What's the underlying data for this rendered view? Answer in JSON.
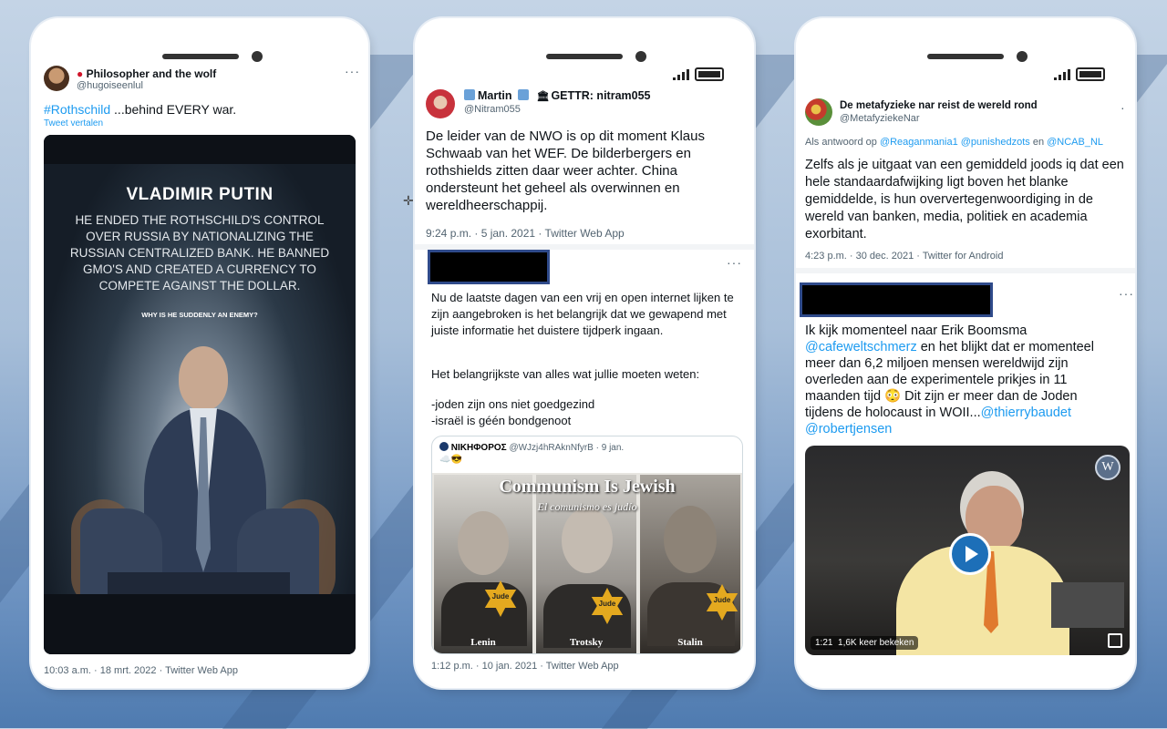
{
  "phone1": {
    "account_name": "Philosopher and the wolf",
    "handle": "@hugoiseenlul",
    "hashtag": "#Rothschild",
    "tweet_rest": " ...behind EVERY war.",
    "translate": "Tweet vertalen",
    "image": {
      "title": "VLADIMIR PUTIN",
      "text": "HE ENDED THE ROTHSCHILD'S CONTROL OVER RUSSIA BY NATIONALIZING THE RUSSIAN CENTRALIZED BANK. HE BANNED GMO'S AND CREATED A CURRENCY TO COMPETE AGAINST THE DOLLAR.",
      "question": "WHY IS HE SUDDENLY AN ENEMY?"
    },
    "timestamp": "10:03 a.m. · 18 mrt. 2022 · Twitter Web App"
  },
  "phone2": {
    "account_name": "Martin",
    "account_extra": "GETTR: nitram055",
    "handle": "@Nitram055",
    "tweet": "De leider van de NWO is op dit moment Klaus Schwaab van het WEF. De bilderbergers en rothshields zitten daar weer achter. China ondersteunt het geheel als overwinnen en wereldheerschappij.",
    "timestamp": "9:24 p.m. · 5 jan. 2021 · Twitter Web App",
    "tweet2_p1": "Nu de laatste dagen van een vrij en open internet lijken te zijn aangebroken is het belangrijk dat we gewapend met juiste informatie het duistere tijdperk ingaan.",
    "tweet2_p2": "Het belangrijkste  van alles wat jullie moeten weten:",
    "tweet2_p3": "-joden zijn ons niet goedgezind",
    "tweet2_p4": "-israël is géén bondgenoot",
    "quote": {
      "name": "ΝΙΚΗΦΟΡΟΣ",
      "handle": "@WJzj4hRAknNfyrB · 9 jan.",
      "emoji": "☁️😎",
      "image_title": "Communism Is Jewish",
      "image_subtitle": "El comunismo es judío",
      "caption1": "Lenin",
      "caption2": "Trotsky",
      "caption3": "Stalin",
      "star_text": "Jude"
    },
    "timestamp2": "1:12 p.m. · 10 jan. 2021 · Twitter Web App"
  },
  "phone3": {
    "account_name": "De metafyzieke nar reist de wereld rond",
    "handle": "@MetafyziekeNar",
    "reply_prefix": "Als antwoord op ",
    "reply_users": "@Reaganmania1 @punishedzots",
    "reply_and": " en ",
    "reply_last": "@NCAB_NL",
    "tweet": "Zelfs als je uitgaat van een gemiddeld joods iq dat een hele standaardafwijking ligt boven het blanke gemiddelde, is hun oververtegenwoordiging in de wereld van banken, media, politiek en academia exorbitant.",
    "timestamp": "4:23 p.m. · 30 dec. 2021 · Twitter for Android",
    "tweet2_a": "Ik kijk momenteel naar Erik Boomsma ",
    "tweet2_link1": "@cafeweltschmerz",
    "tweet2_b": " en het blijkt dat er momenteel meer dan 6,2 miljoen mensen wereldwijd zijn overleden aan de experimentele prikjes in 11 maanden tijd 😳 Dit zijn er meer dan de Joden tijdens de holocaust in WOII...",
    "tweet2_link2": "@thierrybaudet",
    "tweet2_link3": "@robertjensen",
    "video_duration": "1:21",
    "video_views": "1,6K keer bekeken"
  }
}
